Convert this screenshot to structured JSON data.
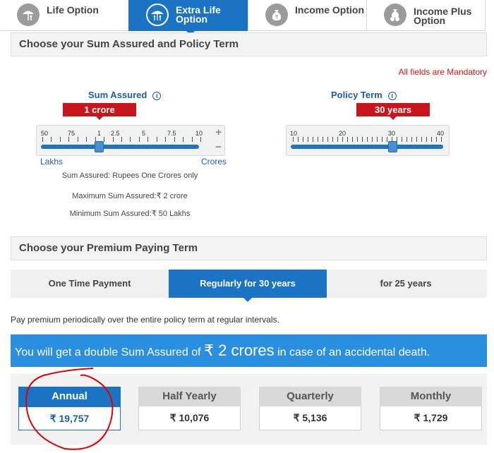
{
  "option_tabs": [
    {
      "label": "Life Option",
      "icon": "umbrella-person-icon"
    },
    {
      "label": "Extra Life Option",
      "icon": "umbrella-family-icon"
    },
    {
      "label": "Income Option",
      "icon": "rupee-bag-icon"
    },
    {
      "label": "Income Plus Option",
      "icon": "rupee-coins-bag-icon"
    }
  ],
  "sum_section": {
    "title": "Choose your Sum Assured and Policy Term",
    "mandatory_note": "All fields are Mandatory",
    "sum_assured": {
      "label": "Sum Assured",
      "info": "i",
      "value": "1 crore",
      "tick_labels": [
        "50",
        "75",
        "1",
        "2.5",
        "5",
        "7.5",
        "10"
      ],
      "plus": "+",
      "minus": "−",
      "min_unit": "Lakhs",
      "max_unit": "Crores",
      "notes": [
        "Sum Assured: Rupees One Crores only",
        "Maximum Sum Assured:₹ 2 crore",
        "Minimum Sum Assured:₹ 50 Lakhs"
      ]
    },
    "policy_term": {
      "label": "Policy Term",
      "info": "i",
      "value": "30 years",
      "tick_labels": [
        "10",
        "20",
        "30",
        "40"
      ],
      "level": 30
    }
  },
  "premium_section": {
    "title": "Choose your Premium Paying Term",
    "tabs": [
      "One Time Payment",
      "Regularly for 30 years",
      "for 25 years"
    ],
    "description": "Pay premium periodically over the entire policy term at regular intervals.",
    "banner": {
      "prefix": "You will get a double Sum Assured of ",
      "amount": "₹ 2 crores",
      "suffix": " in case of an accidental death."
    },
    "frequencies": [
      {
        "label": "Annual",
        "amount": "₹ 19,757"
      },
      {
        "label": "Half Yearly",
        "amount": "₹ 10,076"
      },
      {
        "label": "Quarterly",
        "amount": "₹ 5,136"
      },
      {
        "label": "Monthly",
        "amount": "₹ 1,729"
      }
    ]
  },
  "colors": {
    "primary": "#1b73c4",
    "badge": "#c8161d",
    "banner": "#2b8fe0",
    "annotation": "#e00000"
  }
}
